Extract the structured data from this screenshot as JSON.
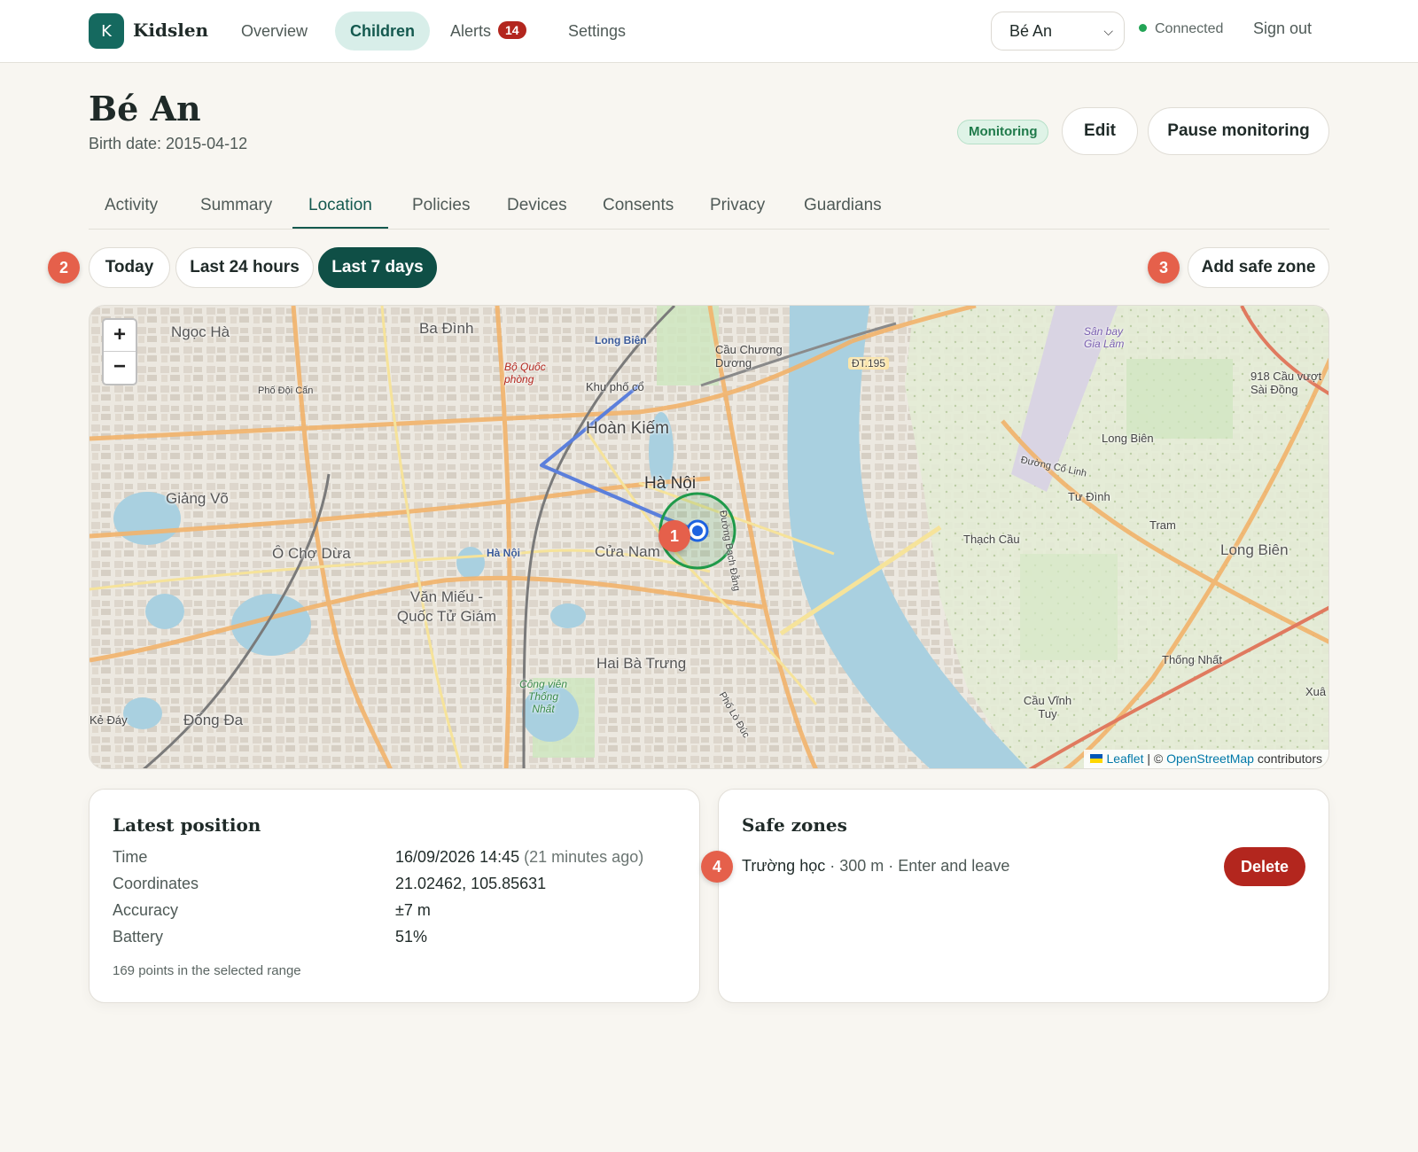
{
  "app": {
    "logo_letter": "K",
    "name": "Kidslen"
  },
  "nav": {
    "items": [
      {
        "label": "Overview"
      },
      {
        "label": "Children"
      },
      {
        "label": "Alerts",
        "badge": "14"
      },
      {
        "label": "Settings"
      }
    ],
    "child_select": {
      "value": "Bé An"
    },
    "connection_status": "Connected",
    "sign_out": "Sign out"
  },
  "child": {
    "name": "Bé An",
    "birth_date": "Birth date: 2015-04-12",
    "status": "Monitoring",
    "edit_label": "Edit",
    "pause_label": "Pause monitoring"
  },
  "tabs": [
    "Activity",
    "Summary",
    "Location",
    "Policies",
    "Devices",
    "Consents",
    "Privacy",
    "Guardians"
  ],
  "active_tab": "Location",
  "range": {
    "options": [
      "Today",
      "Last 24 hours",
      "Last 7 days"
    ],
    "selected": "Last 7 days",
    "add_safe_zone": "Add safe zone"
  },
  "markers": {
    "m1": "1",
    "m2": "2",
    "m3": "3",
    "m4": "4"
  },
  "map": {
    "zoom_in": "+",
    "zoom_out": "−",
    "attribution": {
      "leaflet": "Leaflet",
      "sep": " | © ",
      "osm": "OpenStreetMap",
      "contrib": " contributors"
    },
    "labels": {
      "ngoc_ha": "Ngọc Hà",
      "ba_dinh": "Ba Đình",
      "long_bien_top": "Long Biên",
      "cau_chuong_duong": "Cầu Chương Dương",
      "dt195": "ĐT.195",
      "san_bay": "Sân bay Gia Lâm",
      "cau_vuot": "918 Cầu vượt Sài Đồng",
      "bo_quoc_phong": "Bộ Quốc phòng",
      "khu_pho_co": "Khu phố cổ",
      "hoan_kiem": "Hoàn Kiếm",
      "ha_noi": "Hà Nội",
      "giang_vo": "Giảng Võ",
      "long_bien_mid": "Long Biên",
      "tu_dinh": "Tư Đình",
      "thach_cau": "Thạch Cầu",
      "tram": "Tram",
      "long_bien_right": "Long Biên",
      "o_cho_dua": "Ô Chợ Dừa",
      "cua_nam": "Cửa Nam",
      "ha_noi_station": "Hà Nội",
      "van_mieu": "Văn Miếu - Quốc Tử Giám",
      "hai_ba_trung": "Hai Bà Trưng",
      "thong_nhat": "Thống Nhất",
      "cong_vien": "Công viên Thống Nhất",
      "cau_vinh_tuy": "Cầu Vĩnh Tuy",
      "dong_da": "Đống Đa",
      "ke_day": "Kẻ Đáy",
      "xua": "Xuâ",
      "doi_can": "Phố Đội Cấn",
      "duong_co_linh": "Đường Cổ Linh",
      "bach_dang": "Đường Bạch Đằng",
      "lo_duc": "Phố Lò Đúc"
    },
    "position": {
      "lat": 21.02462,
      "lng": 105.85631
    },
    "safe_zone_radius_m": 300,
    "route_color": "#5b7fdc",
    "zone_color": "#1f9a4a",
    "point_color": "#1e63e0"
  },
  "latest_position": {
    "title": "Latest position",
    "rows": [
      {
        "label": "Time",
        "value": "16/09/2026 14:45",
        "extra": " (21 minutes ago)"
      },
      {
        "label": "Coordinates",
        "value": "21.02462, 105.85631"
      },
      {
        "label": "Accuracy",
        "value": "±7 m"
      },
      {
        "label": "Battery",
        "value": "51%"
      }
    ],
    "points_note": "169 points in the selected range"
  },
  "safe_zones": {
    "title": "Safe zones",
    "items": [
      {
        "name": "Trường học",
        "details": " · 300 m · Enter and leave",
        "delete_label": "Delete"
      }
    ]
  },
  "colors": {
    "brand": "#15695f",
    "accent_marker": "#e5604b",
    "danger": "#b3261e",
    "status_green": "#1f7a4a"
  }
}
